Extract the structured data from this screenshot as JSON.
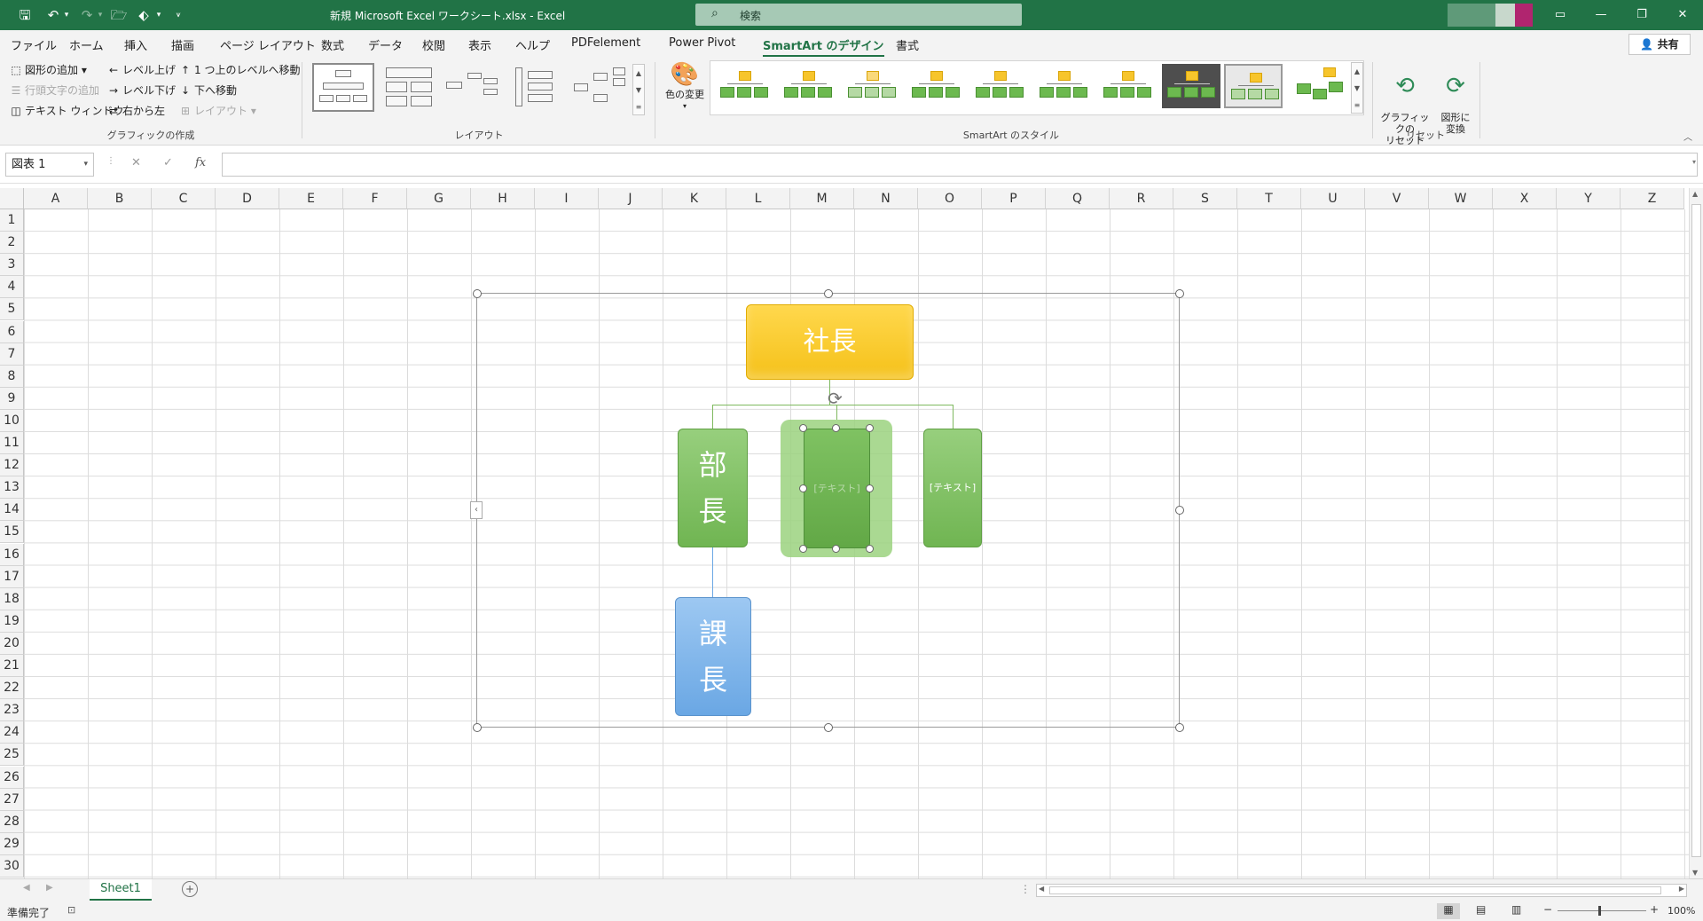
{
  "app": {
    "title": "新規 Microsoft Excel ワークシート.xlsx  -  Excel",
    "search_placeholder": "検索",
    "accent": "#217346"
  },
  "tabs": [
    "ファイル",
    "ホーム",
    "挿入",
    "描画",
    "ページ レイアウト",
    "数式",
    "データ",
    "校閲",
    "表示",
    "ヘルプ",
    "PDFelement",
    "Power Pivot",
    "SmartArt のデザイン",
    "書式"
  ],
  "active_tab": "SmartArt のデザイン",
  "share_label": "共有",
  "ribbon": {
    "create_graphic": {
      "add_shape": "図形の追加",
      "add_bullet": "行頭文字の追加",
      "text_pane": "テキスト ウィンドウ",
      "promote": "レベル上げ",
      "demote": "レベル下げ",
      "rtl": "右から左",
      "move_up": "1 つ上のレベルへ移動",
      "move_down": "下へ移動",
      "layout": "レイアウト",
      "group_label": "グラフィックの作成"
    },
    "layouts_label": "レイアウト",
    "change_colors": "色の変更",
    "styles_label": "SmartArt のスタイル",
    "reset_graphic": "グラフィックの\nリセット",
    "convert": "図形に\n変換",
    "reset_label": "リセット"
  },
  "formula_bar": {
    "name_box": "図表 1",
    "fx": "fx"
  },
  "grid": {
    "columns": [
      "A",
      "B",
      "C",
      "D",
      "E",
      "F",
      "G",
      "H",
      "I",
      "J",
      "K",
      "L",
      "M",
      "N",
      "O",
      "P",
      "Q",
      "R",
      "S",
      "T",
      "U",
      "V",
      "W",
      "X",
      "Y",
      "Z"
    ],
    "rows": [
      "1",
      "2",
      "3",
      "4",
      "5",
      "6",
      "7",
      "8",
      "9",
      "10",
      "11",
      "12",
      "13",
      "14",
      "15",
      "16",
      "17",
      "18",
      "19",
      "20",
      "21",
      "22",
      "23",
      "24",
      "25",
      "26",
      "27",
      "28",
      "29",
      "30"
    ]
  },
  "smartart": {
    "top": "社長",
    "branch1": "部\n長",
    "branch2_placeholder": "[テキスト]",
    "branch3_placeholder": "[テキスト]",
    "child1": "課\n長"
  },
  "sheet_tab": "Sheet1",
  "status": {
    "ready": "準備完了",
    "zoom": "100%"
  }
}
